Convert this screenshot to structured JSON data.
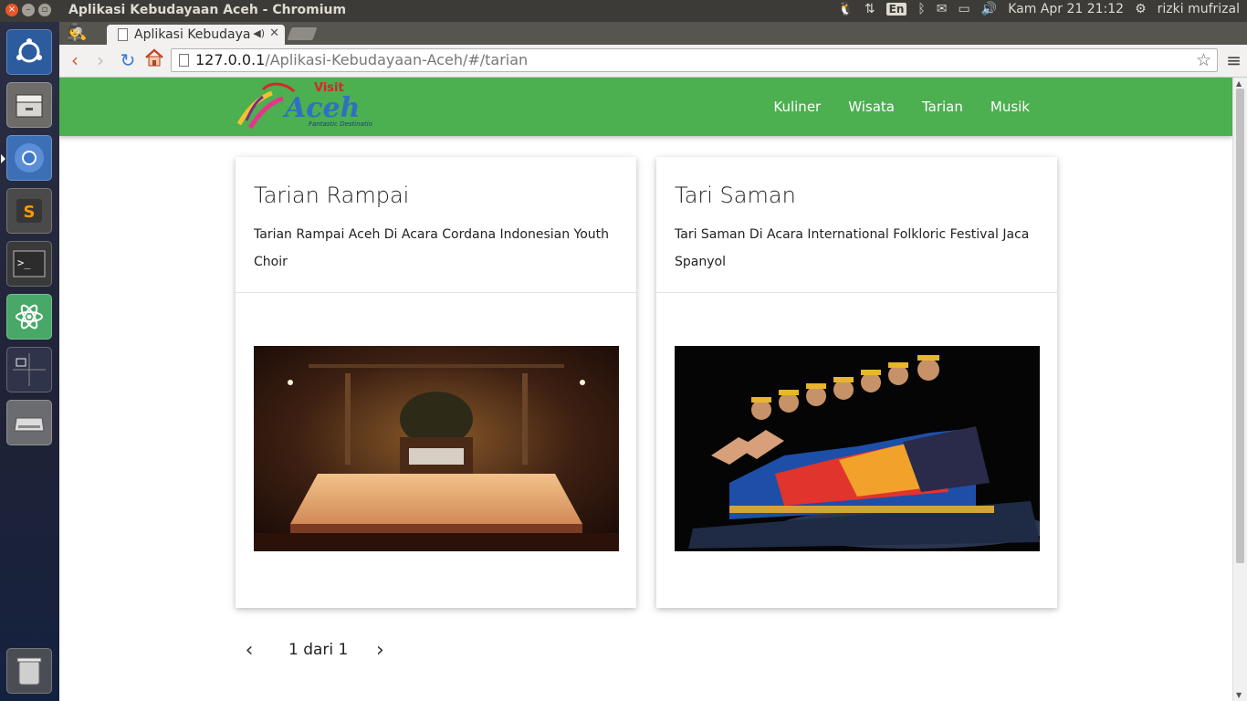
{
  "system_panel": {
    "window_title": "Aplikasi Kebudayaan Aceh - Chromium",
    "keyboard_layout": "En",
    "datetime": "Kam Apr 21 21:12",
    "username": "rizki mufrizal"
  },
  "launcher": {
    "items": [
      "ubuntu-dash-icon",
      "files-icon",
      "chromium-icon",
      "sublime-text-icon",
      "terminal-icon",
      "atom-icon",
      "workspace-switcher-icon",
      "disk-drive-icon",
      "trash-icon"
    ]
  },
  "browser": {
    "tab_title": "Aplikasi Kebudaya",
    "url_host": "127.0.0.1",
    "url_path": "/Aplikasi-Kebudayaan-Aceh/#/tarian"
  },
  "site": {
    "logo": {
      "visit": "Visit",
      "word": "Aceh",
      "tagline": "Fantastic Destination"
    },
    "nav": [
      "Kuliner",
      "Wisata",
      "Tarian",
      "Musik"
    ],
    "brand_color": "#4caf50"
  },
  "cards": [
    {
      "title": "Tarian Rampai",
      "description": "Tarian Rampai Aceh Di Acara Cordana Indonesian Youth Choir",
      "media": "video-concert-hall-stage"
    },
    {
      "title": "Tari Saman",
      "description": "Tari Saman Di Acara International Folkloric Festival Jaca Spanyol",
      "media": "video-saman-dancers"
    }
  ],
  "pagination": {
    "label": "1 dari 1",
    "prev_icon": "chevron-left-icon",
    "next_icon": "chevron-right-icon"
  }
}
